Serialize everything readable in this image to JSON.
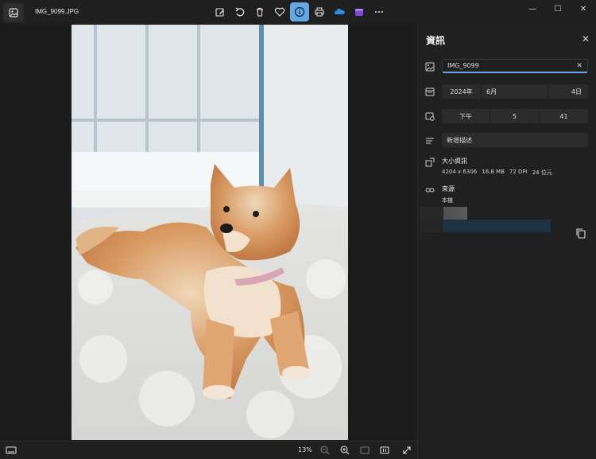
{
  "window": {
    "file_title": "IMG_9099.JPG"
  },
  "toolbar": {
    "items": [
      "edit-icon",
      "rotate-icon",
      "delete-icon",
      "favorite-icon",
      "info-icon",
      "print-icon",
      "onedrive-icon",
      "clipchamp-icon",
      "more-icon"
    ],
    "active": "info-icon"
  },
  "bottombar": {
    "zoom": "13%"
  },
  "info_panel": {
    "title": "資訊",
    "name_value": "IMG_9099",
    "date": {
      "year": "2024年",
      "month": "6月",
      "day": "4日"
    },
    "time": {
      "period": "下午",
      "hour": "5",
      "minute": "41"
    },
    "description_placeholder": "新增描述",
    "size_heading": "大小資訊",
    "dimensions": "4204 x 6306",
    "file_size": "16.8 MB",
    "dpi": "72 DPI",
    "bit_depth": "24 位元",
    "source_heading": "來源",
    "source_value": "本機"
  },
  "colors": {
    "accent": "#63a8e4",
    "background": "#1c1c1c",
    "panel": "#202020"
  }
}
